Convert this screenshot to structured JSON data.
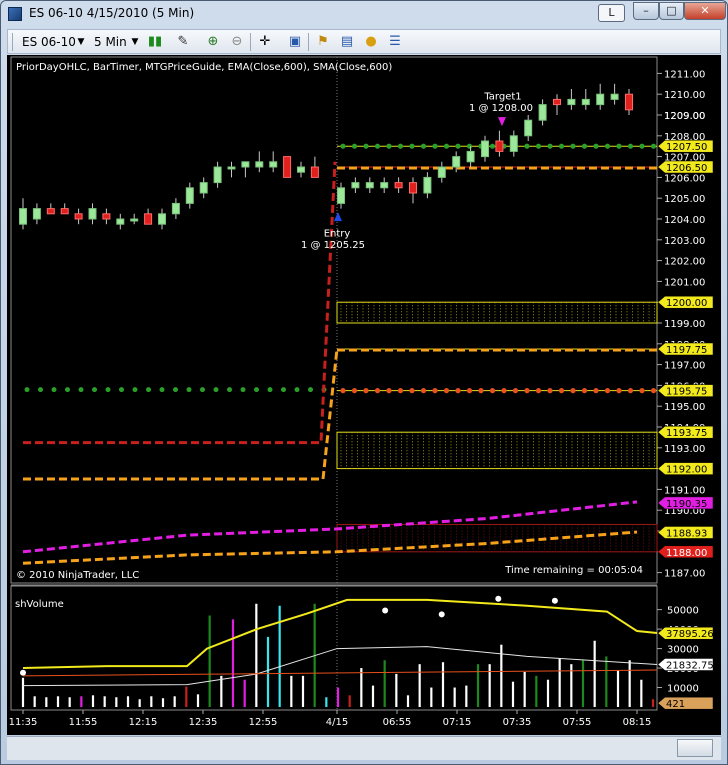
{
  "window": {
    "title": "ES 06-10  4/15/2010 (5 Min)",
    "controls": {
      "linked_label": "L",
      "minimize": "–",
      "maximize": "□",
      "close": "✕"
    }
  },
  "toolbar": {
    "instrument": "ES 06-10",
    "interval": "5 Min",
    "icons": [
      "instrument-dropdown-icon",
      "interval-dropdown-icon",
      "bar-type-icon",
      "drawing-tool-icon",
      "zoom-in-icon",
      "zoom-out-icon",
      "crosshair-icon",
      "properties-icon",
      "strategies-icon",
      "indicators-icon",
      "chart-trader-icon",
      "data-box-icon"
    ]
  },
  "price_panel": {
    "indicators_label": "PriorDayOHLC, BarTimer, MTGPriceGuide, EMA(Close,600), SMA(Close,600)",
    "copyright": "© 2010 NinjaTrader, LLC",
    "time_remaining": "Time remaining = 00:05:04",
    "y_ticks": [
      "1211.00",
      "1210.00",
      "1209.00",
      "1208.00",
      "1207.00",
      "1206.00",
      "1205.00",
      "1204.00",
      "1203.00",
      "1202.00",
      "1201.00",
      "1200.00",
      "1199.00",
      "1198.00",
      "1197.00",
      "1196.00",
      "1195.00",
      "1194.00",
      "1193.00",
      "1192.00",
      "1191.00",
      "1190.00",
      "1189.00",
      "1188.00",
      "1187.00"
    ],
    "price_tags": [
      {
        "text": "1207.50",
        "color": "#f2ea1c"
      },
      {
        "text": "1206.50",
        "color": "#f2ea1c"
      },
      {
        "text": "1200.00",
        "color": "#f2ea1c"
      },
      {
        "text": "1197.75",
        "color": "#f2ea1c"
      },
      {
        "text": "1195.75",
        "color": "#f2ea1c"
      },
      {
        "text": "1193.75",
        "color": "#f2ea1c"
      },
      {
        "text": "1192.00",
        "color": "#f2ea1c"
      },
      {
        "text": "1190.35",
        "color": "#e21ee2"
      },
      {
        "text": "1188.93",
        "color": "#f2ea1c"
      },
      {
        "text": "1188.00",
        "color": "#e0201c"
      }
    ],
    "annotations": {
      "entry_label": "Entry",
      "entry_detail": "1 @ 1205.25",
      "target_label": "Target1",
      "target_detail": "1 @ 1208.00"
    }
  },
  "volume_panel": {
    "label": "shVolume",
    "y_ticks": [
      "50000",
      "40000",
      "30000",
      "20000",
      "10000"
    ],
    "tags": [
      {
        "text": "37895.26",
        "color": "#f2ea1c"
      },
      {
        "text": "21832.75",
        "color": "#ffffff"
      },
      {
        "text": "421",
        "color": "#d9a15a"
      }
    ]
  },
  "x_axis": {
    "labels": [
      "11:35",
      "11:55",
      "12:15",
      "12:35",
      "12:55",
      "4/15",
      "06:55",
      "07:15",
      "07:35",
      "07:55",
      "08:15"
    ]
  },
  "colors": {
    "up_candle": "#9be89b",
    "down_candle": "#e0201c",
    "ema": "#e21ee2",
    "sma": "#f7a21b",
    "prior_day_red": "#c8201c",
    "guide_yellow": "#e6e21c",
    "dot_green": "#2aa02a"
  },
  "chart_data": {
    "type": "candlestick",
    "instrument": "ES 06-10",
    "interval": "5 Min",
    "ylim": [
      1186.5,
      1211.5
    ],
    "candles": [
      {
        "x": "11:35",
        "o": 1203.75,
        "h": 1205.0,
        "l": 1203.5,
        "c": 1204.5
      },
      {
        "x": "11:40",
        "o": 1204.0,
        "h": 1204.75,
        "l": 1203.75,
        "c": 1204.5
      },
      {
        "x": "11:45",
        "o": 1204.5,
        "h": 1204.75,
        "l": 1204.25,
        "c": 1204.25
      },
      {
        "x": "11:50",
        "o": 1204.5,
        "h": 1204.75,
        "l": 1204.25,
        "c": 1204.25
      },
      {
        "x": "11:55",
        "o": 1204.25,
        "h": 1204.5,
        "l": 1203.75,
        "c": 1204.0
      },
      {
        "x": "12:00",
        "o": 1204.0,
        "h": 1204.75,
        "l": 1203.75,
        "c": 1204.5
      },
      {
        "x": "12:05",
        "o": 1204.25,
        "h": 1204.5,
        "l": 1203.75,
        "c": 1204.0
      },
      {
        "x": "12:10",
        "o": 1203.75,
        "h": 1204.25,
        "l": 1203.5,
        "c": 1204.0
      },
      {
        "x": "12:15",
        "o": 1204.0,
        "h": 1204.25,
        "l": 1203.75,
        "c": 1204.0
      },
      {
        "x": "12:20",
        "o": 1204.25,
        "h": 1204.5,
        "l": 1203.75,
        "c": 1203.75
      },
      {
        "x": "12:25",
        "o": 1203.75,
        "h": 1204.5,
        "l": 1203.5,
        "c": 1204.25
      },
      {
        "x": "12:30",
        "o": 1204.25,
        "h": 1205.0,
        "l": 1204.0,
        "c": 1204.75
      },
      {
        "x": "12:35",
        "o": 1204.75,
        "h": 1205.75,
        "l": 1204.5,
        "c": 1205.5
      },
      {
        "x": "12:40",
        "o": 1205.25,
        "h": 1206.0,
        "l": 1205.0,
        "c": 1205.75
      },
      {
        "x": "12:45",
        "o": 1205.75,
        "h": 1206.75,
        "l": 1205.5,
        "c": 1206.5
      },
      {
        "x": "12:50",
        "o": 1206.5,
        "h": 1206.75,
        "l": 1206.0,
        "c": 1206.5
      },
      {
        "x": "12:55",
        "o": 1206.5,
        "h": 1206.75,
        "l": 1206.0,
        "c": 1206.75
      },
      {
        "x": "13:00",
        "o": 1206.5,
        "h": 1207.25,
        "l": 1206.25,
        "c": 1206.75
      },
      {
        "x": "13:05",
        "o": 1206.5,
        "h": 1207.25,
        "l": 1206.25,
        "c": 1206.75
      },
      {
        "x": "13:10",
        "o": 1207.0,
        "h": 1207.0,
        "l": 1206.0,
        "c": 1206.0
      },
      {
        "x": "13:15",
        "o": 1206.25,
        "h": 1206.75,
        "l": 1206.0,
        "c": 1206.5
      },
      {
        "x": "13:20",
        "o": 1206.5,
        "h": 1207.0,
        "l": 1206.0,
        "c": 1206.0
      },
      {
        "x": "06:35",
        "o": 1204.75,
        "h": 1205.75,
        "l": 1204.5,
        "c": 1205.5
      },
      {
        "x": "06:40",
        "o": 1205.5,
        "h": 1206.0,
        "l": 1205.25,
        "c": 1205.75
      },
      {
        "x": "06:45",
        "o": 1205.5,
        "h": 1206.0,
        "l": 1205.25,
        "c": 1205.75
      },
      {
        "x": "06:50",
        "o": 1205.5,
        "h": 1206.0,
        "l": 1205.25,
        "c": 1205.75
      },
      {
        "x": "06:55",
        "o": 1205.75,
        "h": 1206.0,
        "l": 1205.25,
        "c": 1205.5
      },
      {
        "x": "07:00",
        "o": 1205.75,
        "h": 1206.0,
        "l": 1204.75,
        "c": 1205.25
      },
      {
        "x": "07:05",
        "o": 1205.25,
        "h": 1206.25,
        "l": 1205.0,
        "c": 1206.0
      },
      {
        "x": "07:10",
        "o": 1206.0,
        "h": 1206.75,
        "l": 1205.75,
        "c": 1206.5
      },
      {
        "x": "07:15",
        "o": 1206.5,
        "h": 1207.25,
        "l": 1206.25,
        "c": 1207.0
      },
      {
        "x": "07:20",
        "o": 1206.75,
        "h": 1207.5,
        "l": 1206.5,
        "c": 1207.25
      },
      {
        "x": "07:25",
        "o": 1207.0,
        "h": 1208.0,
        "l": 1206.75,
        "c": 1207.75
      },
      {
        "x": "07:30",
        "o": 1207.75,
        "h": 1208.25,
        "l": 1207.0,
        "c": 1207.25
      },
      {
        "x": "07:35",
        "o": 1207.25,
        "h": 1208.25,
        "l": 1207.0,
        "c": 1208.0
      },
      {
        "x": "07:40",
        "o": 1208.0,
        "h": 1209.0,
        "l": 1207.75,
        "c": 1208.75
      },
      {
        "x": "07:45",
        "o": 1208.75,
        "h": 1209.75,
        "l": 1208.5,
        "c": 1209.5
      },
      {
        "x": "07:50",
        "o": 1209.75,
        "h": 1210.0,
        "l": 1209.0,
        "c": 1209.5
      },
      {
        "x": "07:55",
        "o": 1209.5,
        "h": 1210.25,
        "l": 1209.25,
        "c": 1209.75
      },
      {
        "x": "08:00",
        "o": 1209.5,
        "h": 1210.25,
        "l": 1209.25,
        "c": 1209.75
      },
      {
        "x": "08:05",
        "o": 1209.5,
        "h": 1210.5,
        "l": 1209.25,
        "c": 1210.0
      },
      {
        "x": "08:10",
        "o": 1209.75,
        "h": 1210.5,
        "l": 1209.5,
        "c": 1210.0
      },
      {
        "x": "08:15",
        "o": 1210.0,
        "h": 1210.25,
        "l": 1209.0,
        "c": 1209.25
      }
    ],
    "volume": {
      "ylim": [
        0,
        57000
      ],
      "values": [
        15000,
        5500,
        5000,
        5500,
        5000,
        5500,
        6000,
        5500,
        5000,
        5500,
        4000,
        5500,
        4500,
        5500,
        10500,
        6500,
        47000,
        16000,
        45000,
        14000,
        53000,
        36000,
        52000,
        16000,
        16000,
        53000,
        5000,
        10000,
        6000,
        20000,
        11000,
        24000,
        17000,
        6000,
        22000,
        10000,
        23000,
        10000,
        11000,
        22000,
        22000,
        32000,
        13000,
        18000,
        16000,
        14000,
        25000,
        22000,
        24000,
        34000,
        26000,
        19000,
        24000,
        14000,
        4000
      ],
      "colors": [
        "#ffffff",
        "#ffffff",
        "#ffffff",
        "#ffffff",
        "#ffffff",
        "#e21ee2",
        "#ffffff",
        "#ffffff",
        "#ffffff",
        "#ffffff",
        "#ffffff",
        "#ffffff",
        "#ffffff",
        "#ffffff",
        "#c8201c",
        "#ffffff",
        "#1e8a1e",
        "#ffffff",
        "#e21ee2",
        "#e21ee2",
        "#ffffff",
        "#39e6f0",
        "#39e6f0",
        "#ffffff",
        "#ffffff",
        "#1e8a1e",
        "#39e6f0",
        "#e21ee2",
        "#c8201c",
        "#ffffff",
        "#ffffff",
        "#1e8a1e",
        "#ffffff",
        "#ffffff",
        "#ffffff",
        "#ffffff",
        "#ffffff",
        "#ffffff",
        "#ffffff",
        "#1e8a1e",
        "#ffffff",
        "#ffffff",
        "#ffffff",
        "#ffffff",
        "#1e8a1e",
        "#ffffff",
        "#ffffff",
        "#ffffff",
        "#1e8a1e",
        "#ffffff",
        "#1e8a1e",
        "#ffffff",
        "#ffffff",
        "#ffffff",
        "#c8201c"
      ]
    },
    "levels": {
      "target_level": 1207.5,
      "entry_level": 1206.5,
      "zone1": [
        1199.0,
        1200.0
      ],
      "guide_1197_75": 1197.75,
      "guide_1195_75": 1195.75,
      "zone2": [
        1192.0,
        1193.75
      ],
      "ema_last": 1190.35,
      "sma_last": 1188.93,
      "prior_day_low": 1188.0
    }
  }
}
